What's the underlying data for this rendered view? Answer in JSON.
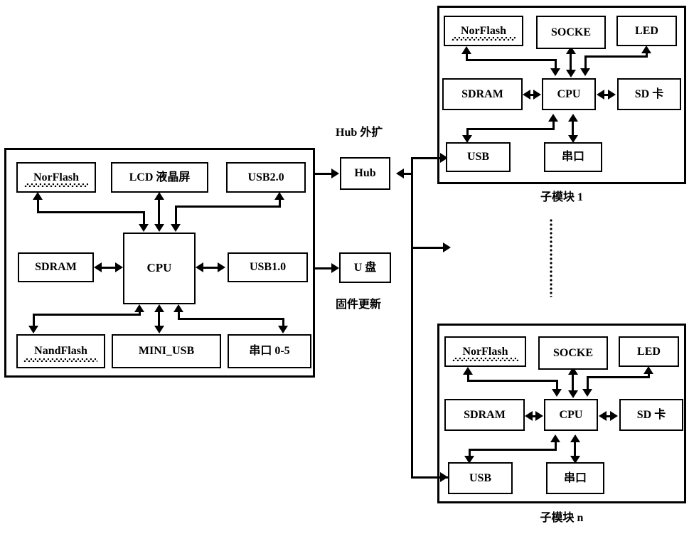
{
  "diagram": {
    "title": "Embedded main module and sub-module block diagram",
    "main_module": {
      "blocks": {
        "norflash": "NorFlash",
        "lcd": "LCD 液晶屏",
        "usb20": "USB2.0",
        "sdram": "SDRAM",
        "cpu": "CPU",
        "usb10": "USB1.0",
        "nandflash": "NandFlash",
        "mini_usb": "MINI_USB",
        "serial": "串口 0-5"
      }
    },
    "middle": {
      "hub_label": "Hub 外扩",
      "hub_block": "Hub",
      "udisk_block": "U 盘",
      "udisk_label": "固件更新"
    },
    "submodule_1": {
      "caption": "子模块 1",
      "blocks": {
        "norflash": "NorFlash",
        "socke": "SOCKE",
        "led": "LED",
        "sdram": "SDRAM",
        "cpu": "CPU",
        "sdcard": "SD 卡",
        "usb": "USB",
        "serial": "串口"
      }
    },
    "submodule_n": {
      "caption": "子模块 n",
      "blocks": {
        "norflash": "NorFlash",
        "socke": "SOCKE",
        "led": "LED",
        "sdram": "SDRAM",
        "cpu": "CPU",
        "sdcard": "SD 卡",
        "usb": "USB",
        "serial": "串口"
      }
    },
    "colors": {
      "line": "#000000",
      "background": "#ffffff",
      "text": "#000000"
    }
  }
}
